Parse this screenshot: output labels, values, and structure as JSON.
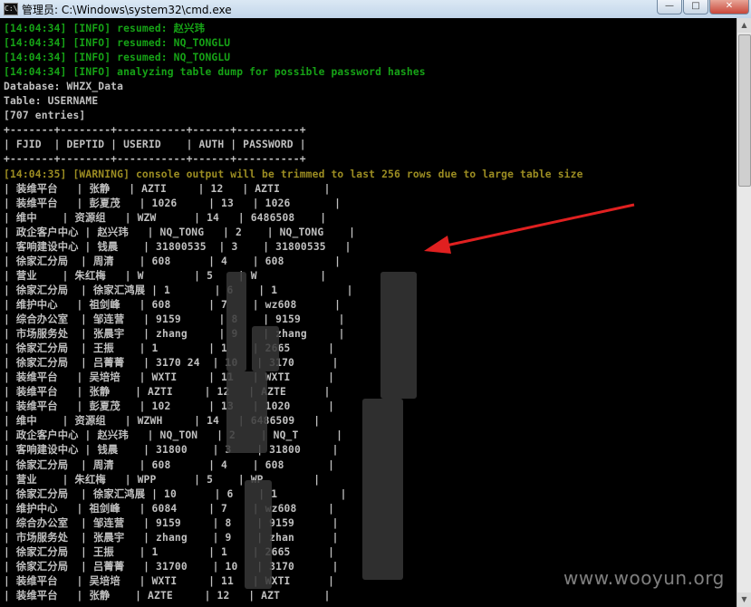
{
  "window": {
    "title": "管理员: C:\\Windows\\system32\\cmd.exe",
    "icon": "cmd-icon",
    "buttons": {
      "minimize": "—",
      "maximize": "□",
      "close": "✕"
    }
  },
  "console_lines": [
    "[14:04:34] [INFO] resumed: 赵兴玮",
    "[14:04:34] [INFO] resumed: NQ_TONGLU",
    "[14:04:34] [INFO] resumed: NQ_TONGLU",
    "[14:04:34] [INFO] analyzing table dump for possible password hashes",
    "Database: WHZX_Data",
    "Table: USERNAME",
    "[707 entries]",
    "+-------+--------+-----------+------+----------+",
    "| FJID  | DEPTID | USERID    | AUTH | PASSWORD |",
    "+-------+--------+-----------+------+----------+",
    "[14:04:35] [WARNING] console output will be trimmed to last 256 rows due to large table size",
    "| 装维平台   | 张静   | AZTI     | 12   | AZTI       |",
    "| 装维平台   | 彭夏茂   | 1026     | 13   | 1026       |",
    "| 维中    | 资源组   | WZW      | 14   | 6486508    |",
    "| 政企客户中心 | 赵兴玮   | NQ_TONG   | 2    | NQ_TONG    |",
    "| 客响建设中心 | 钱晨    | 31800535  | 3    | 31800535   |",
    "| 徐家汇分局  | 周清    | 608      | 4    | 608        |",
    "| 营业    | 朱红梅   | W        | 5    | W          |",
    "| 徐家汇分局  | 徐家汇鸿展 | 1       | 6    | 1           |",
    "| 维护中心   | 祖剑峰   | 608      | 7    | wz608      |",
    "| 综合办公室  | 邹连营   | 9159      | 8    | 9159      |",
    "| 市场服务处  | 张晨宇   | zhang     | 9    | zhang     |",
    "| 徐家汇分局  | 王振    | 1        | 1    | 2665      |",
    "| 徐家汇分局  | 吕菁菁   | 3170 24  | 10   | 3170      |",
    "| 装维平台   | 吴培培   | WXTI     | 11   | WXTI      |",
    "| 装维平台   | 张静    | AZTI     | 12   | AZTE      |",
    "| 装维平台   | 彭夏茂   | 102      | 13   | 1020      |",
    "| 维中    | 资源组   | WZWH     | 14   | 6486509   |",
    "| 政企客户中心 | 赵兴玮   | NQ_TON   | 2    | NQ_T      |",
    "| 客响建设中心 | 钱晨    | 31800    | 3    | 31800     |",
    "| 徐家汇分局  | 周清    | 608      | 4    | 608       |",
    "| 营业    | 朱红梅   | WPP      | 5    | WP        |",
    "| 徐家汇分局  | 徐家汇鸿展 | 10      | 6    | 1          |",
    "| 维护中心   | 祖剑峰   | 6084     | 7    | wz608     |",
    "| 综合办公室  | 邹连营   | 9159     | 8    | 9159      |",
    "| 市场服务处  | 张晨宇   | zhang    | 9    | zhan      |",
    "| 徐家汇分局  | 王振    | 1        | 1    | 2665      |",
    "| 徐家汇分局  | 吕菁菁   | 31700    | 10   | 3170      |",
    "| 装维平台   | 吴培培   | WXTI     | 11   | WXTI      |",
    "| 装维平台   | 张静    | AZTE     | 12   | AZT       |"
  ],
  "line_styles": [
    "g",
    "g",
    "g",
    "g",
    "w",
    "w",
    "w",
    "w",
    "w",
    "w",
    "y",
    "w",
    "w",
    "w",
    "w",
    "w",
    "w",
    "w",
    "w",
    "w",
    "w",
    "w",
    "w",
    "w",
    "w",
    "w",
    "w",
    "w",
    "w",
    "w",
    "w",
    "w",
    "w",
    "w",
    "w",
    "w",
    "w",
    "w",
    "w",
    "w"
  ],
  "colors": {
    "console_bg": "#000000",
    "info_text": "#16a316",
    "warning_text": "#9c8d22",
    "plain_text": "#c0c0c0",
    "arrow": "#e02020"
  },
  "watermark": "www.wooyun.org"
}
